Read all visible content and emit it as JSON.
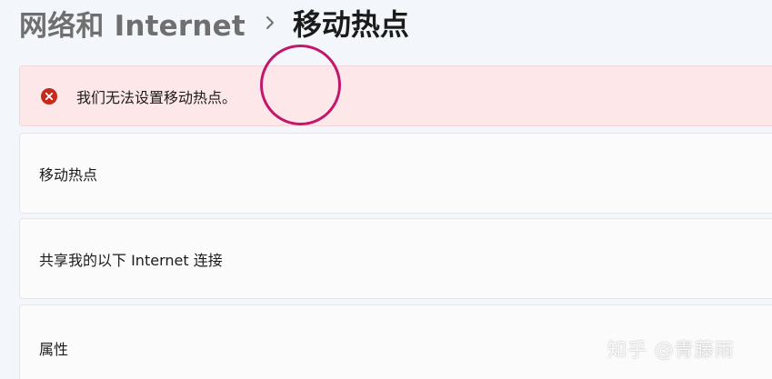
{
  "breadcrumb": {
    "parent": "网络和 Internet",
    "separator_icon": "chevron-right-icon",
    "current": "移动热点"
  },
  "error_banner": {
    "icon": "error-circle-icon",
    "message": "我们无法设置移动热点。",
    "colors": {
      "background": "#fde7e9",
      "icon": "#c42b1c"
    }
  },
  "settings": {
    "items": [
      {
        "label": "移动热点"
      },
      {
        "label": "共享我的以下 Internet 连接"
      },
      {
        "label": "属性"
      }
    ]
  },
  "overlay": {
    "click_indicator_color": "#c2176c",
    "watermark": "知乎 @青藤雨"
  }
}
